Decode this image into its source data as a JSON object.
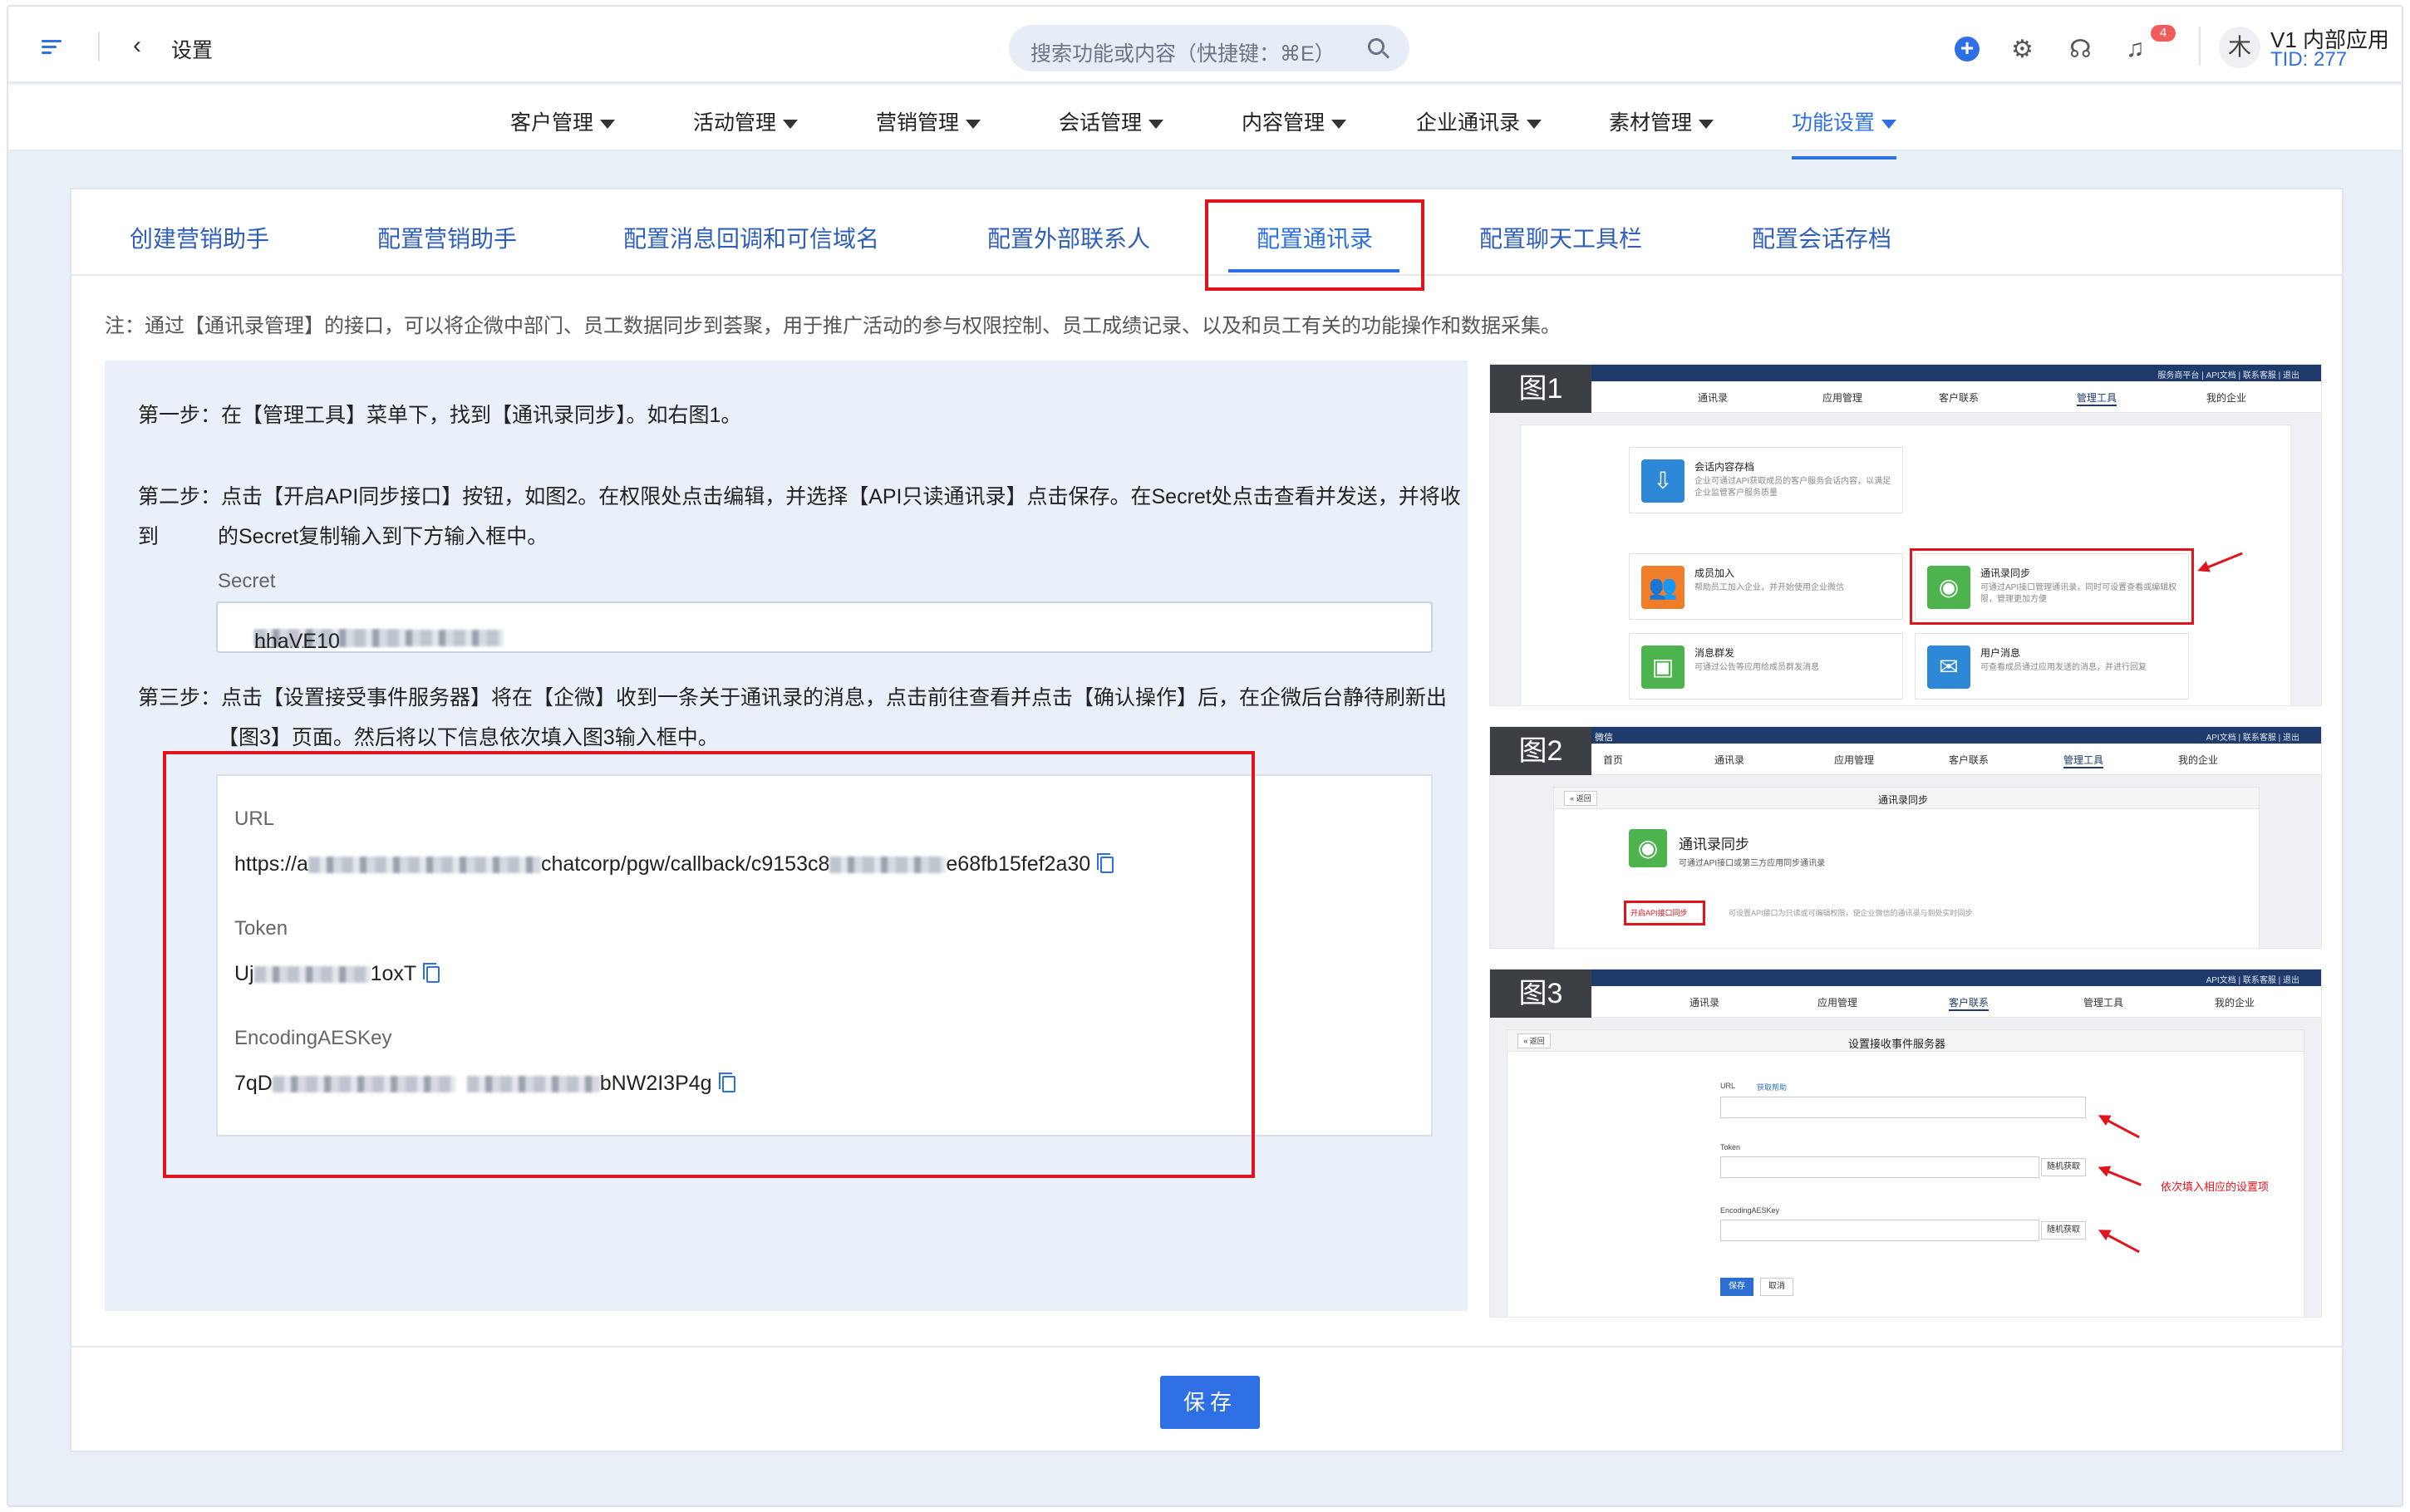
{
  "header": {
    "title": "设置",
    "search_placeholder": "搜索功能或内容（快捷键：⌘E）",
    "notification_count": "4",
    "avatar_text": "木",
    "org_name": "V1 内部应用",
    "org_tid": "TID: 277"
  },
  "nav": {
    "items": [
      "客户管理",
      "活动管理",
      "营销管理",
      "会话管理",
      "内容管理",
      "企业通讯录",
      "素材管理",
      "功能设置"
    ],
    "active": "功能设置"
  },
  "tabs": {
    "items": [
      "创建营销助手",
      "配置营销助手",
      "配置消息回调和可信域名",
      "配置外部联系人",
      "配置通讯录",
      "配置聊天工具栏",
      "配置会话存档"
    ],
    "active": "配置通讯录"
  },
  "note": "注：通过【通讯录管理】的接口，可以将企微中部门、员工数据同步到荟聚，用于推广活动的参与权限控制、员工成绩记录、以及和员工有关的功能操作和数据采集。",
  "steps": {
    "step1": "第一步：在【管理工具】菜单下，找到【通讯录同步】。如右图1。",
    "step2_line1": "第二步：点击【开启API同步接口】按钮，如图2。在权限处点击编辑，并选择【API只读通讯录】点击保存。在Secret处点击查看并发送，并将收到",
    "step2_line2": "的Secret复制输入到下方输入框中。",
    "step3_line1": "第三步：点击【设置接受事件服务器】将在【企微】收到一条关于通讯录的消息，点击前往查看并点击【确认操作】后，在企微后台静待刷新出",
    "step3_line2": "【图3】页面。然后将以下信息依次填入图3输入框中。"
  },
  "secret": {
    "label": "Secret",
    "value_start": "Zsohn",
    "value_end": "hhaVE10"
  },
  "info": {
    "url_label": "URL",
    "url_start": "https://a",
    "url_mid": "chatcorp/pgw/callback/c9153c8",
    "url_end": "e68fb15fef2a30",
    "token_label": "Token",
    "token_start": "Uj",
    "token_end": "1oxT",
    "aes_label": "EncodingAESKey",
    "aes_start": "7qD",
    "aes_end": "bNW2I3P4g"
  },
  "figures": {
    "fig1": {
      "tag": "图1",
      "top_links": "服务商平台 | API文档 | 联系客服 | 退出",
      "menu": [
        "通讯录",
        "应用管理",
        "客户联系",
        "管理工具",
        "我的企业"
      ],
      "cards": [
        {
          "title": "会话内容存档",
          "desc": "企业可通过API获取成员的客户服务会话内容，以满足企业监管客户服务质量"
        },
        {
          "title": "成员加入",
          "desc": "帮助员工加入企业，并开始使用企业微信"
        },
        {
          "title": "通讯录同步",
          "desc": "可通过API接口管理通讯录，同时可设置查看或编辑权限，管理更加方便"
        },
        {
          "title": "消息群发",
          "desc": "可通过公告等应用给成员群发消息"
        },
        {
          "title": "用户消息",
          "desc": "可查看成员通过应用发送的消息，并进行回复"
        }
      ]
    },
    "fig2": {
      "tag": "图2",
      "brand": "微信",
      "top_links": "API文档 | 联系客服 | 退出",
      "menu": [
        "首页",
        "通讯录",
        "应用管理",
        "客户联系",
        "管理工具",
        "我的企业"
      ],
      "back": "« 返回",
      "header": "通讯录同步",
      "title": "通讯录同步",
      "desc": "可通过API接口或第三方应用同步通讯录",
      "btn": "开启API接口同步",
      "btn_desc": "可设置API接口为只读或可编辑权限，使企业微信的通讯录与到处实时同步"
    },
    "fig3": {
      "tag": "图3",
      "top_links": "API文档 | 联系客服 | 退出",
      "menu": [
        "通讯录",
        "应用管理",
        "客户联系",
        "管理工具",
        "我的企业"
      ],
      "back": "« 返回",
      "header": "设置接收事件服务器",
      "url_label": "URL",
      "url_help": "获取帮助",
      "token_label": "Token",
      "aes_label": "EncodingAESKey",
      "random_btn": "随机获取",
      "save": "保存",
      "cancel": "取消",
      "annotation": "依次填入相应的设置项"
    }
  },
  "footer": {
    "save_label": "保存"
  },
  "colors": {
    "accent": "#2f6fe4",
    "highlight_red": "#e0141d"
  }
}
